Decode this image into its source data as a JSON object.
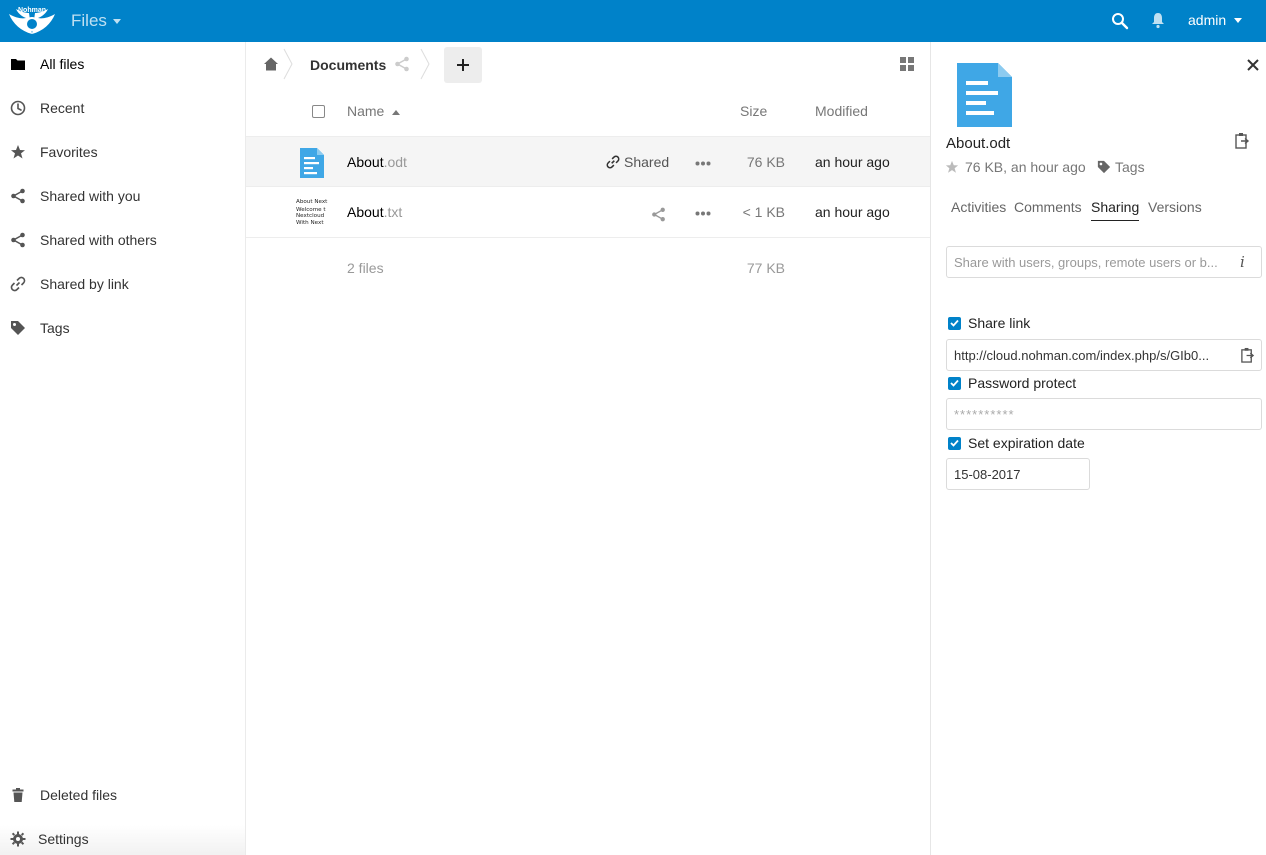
{
  "header": {
    "brand": "Nohman Network",
    "app_title": "Files",
    "user": "admin"
  },
  "sidebar": {
    "items": [
      {
        "label": "All files",
        "icon": "folder-icon"
      },
      {
        "label": "Recent",
        "icon": "clock-icon"
      },
      {
        "label": "Favorites",
        "icon": "star-icon"
      },
      {
        "label": "Shared with you",
        "icon": "share-icon"
      },
      {
        "label": "Shared with others",
        "icon": "share-icon"
      },
      {
        "label": "Shared by link",
        "icon": "link-icon"
      },
      {
        "label": "Tags",
        "icon": "tag-icon"
      }
    ],
    "deleted": "Deleted files",
    "settings": "Settings"
  },
  "breadcrumb": {
    "current": "Documents"
  },
  "table": {
    "headers": {
      "name": "Name",
      "size": "Size",
      "modified": "Modified"
    },
    "rows": [
      {
        "base": "About",
        "ext": ".odt",
        "share_label": "Shared",
        "size": "76 KB",
        "modified": "an hour ago"
      },
      {
        "base": "About",
        "ext": ".txt",
        "share_label": "",
        "size": "< 1 KB",
        "modified": "an hour ago",
        "thumb_lines": [
          "About Next",
          "Welcome t",
          "Nextcloud",
          "With Next"
        ]
      }
    ],
    "summary": {
      "count": "2 files",
      "size": "77 KB"
    }
  },
  "details": {
    "title": "About.odt",
    "meta": "76 KB, an hour ago",
    "tags_label": "Tags",
    "tabs": [
      "Activities",
      "Comments",
      "Sharing",
      "Versions"
    ],
    "active_tab": "Sharing",
    "share_placeholder": "Share with users, groups, remote users or b...",
    "share_link_label": "Share link",
    "share_link_url": "http://cloud.nohman.com/index.php/s/GIb0...",
    "password_label": "Password protect",
    "password_value": "**********",
    "expiration_label": "Set expiration date",
    "expiration_value": "15-08-2017"
  },
  "colors": {
    "brand": "#0082c9",
    "file_icon": "#3fa7e6"
  }
}
